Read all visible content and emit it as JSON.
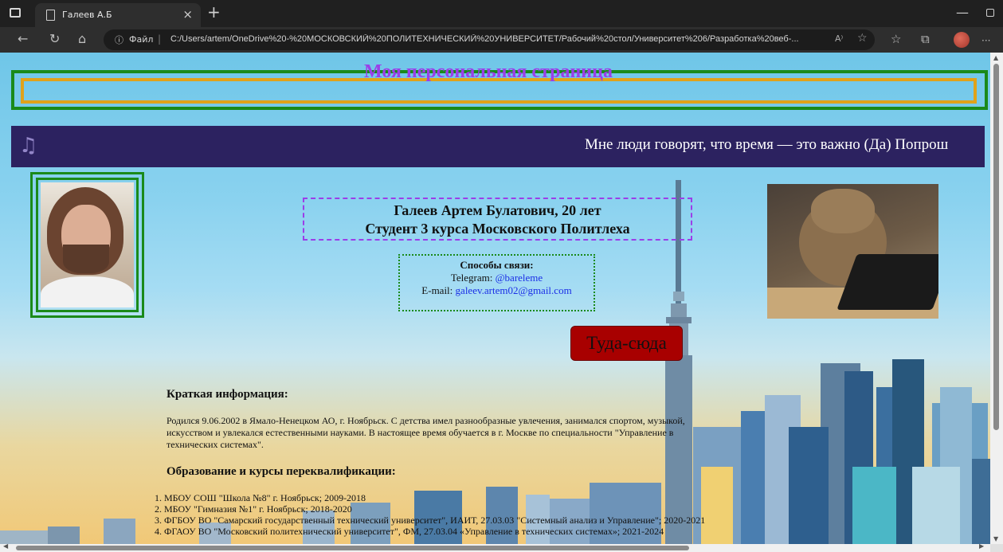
{
  "browser": {
    "tab_title": "Галеев А.Б",
    "tab_close": "×",
    "new_tab": "+",
    "address_info": "ⓘ",
    "address_prefix": "Файл",
    "address_sep": "|",
    "url": "C:/Users/artem/OneDrive%20-%20МОСКОВСКИЙ%20ПОЛИТЕХНИЧЕСКИЙ%20УНИВЕРСИТЕТ/Рабочий%20стол/Университет%206/Разработка%20веб-...",
    "read_aloud": "A⁾",
    "menu": "···"
  },
  "page": {
    "header_title": "Моя персональная страница",
    "music_marquee": "Мне люди говорят, что время — это важно (Да) Попрош",
    "name_line1": "Галеев Артем Булатович, 20 лет",
    "name_line2": "Студент 3 курса Московского Политлеха",
    "contacts": {
      "heading": "Способы связи:",
      "telegram_label": "Telegram:",
      "telegram_value": "@bareleme",
      "email_label": "E-mail:",
      "email_value": "galeev.artem02@gmail.com"
    },
    "toggle_button": "Туда-сюда",
    "brief_heading": "Краткая информация:",
    "brief_text": "Родился 9.06.2002 в Ямало-Ненецком АО, г. Ноябрьск. С детства имел разнообразные увлечения, занимался спортом, музыкой, искусством и увлекался естественными науками. В настоящее время обучается в г. Москве по специальности \"Управление в технических системах\".",
    "education_heading": "Образование и курсы переквалификации:",
    "education": [
      "1. МБОУ СОШ \"Школа №8\" г. Ноябрьск; 2009-2018",
      "2. МБОУ \"Гимназия №1\" г. Ноябрьск; 2018-2020",
      "3. ФГБОУ ВО \"Самарский государственный технический университет\", ИАИТ, 27.03.03 \"Системный анализ и Управление\"; 2020-2021",
      "4. ФГАОУ ВО \"Московский политехнический университет\", ФМ, 27.03.04 «Управление в технических системах»; 2021-2024"
    ]
  },
  "icons": {
    "music": "♫",
    "back": "←",
    "reload": "↻",
    "home": "⌂",
    "favorites": "☆",
    "collections": "⧉",
    "extensions": "⊕"
  },
  "colors": {
    "header_title": "#9b3fe8",
    "header_outer_border": "#1a8a1a",
    "header_inner_border": "#e0a21a",
    "music_bar": "#2c2260",
    "button_bg": "#a80000",
    "link": "#1b2ee6"
  }
}
